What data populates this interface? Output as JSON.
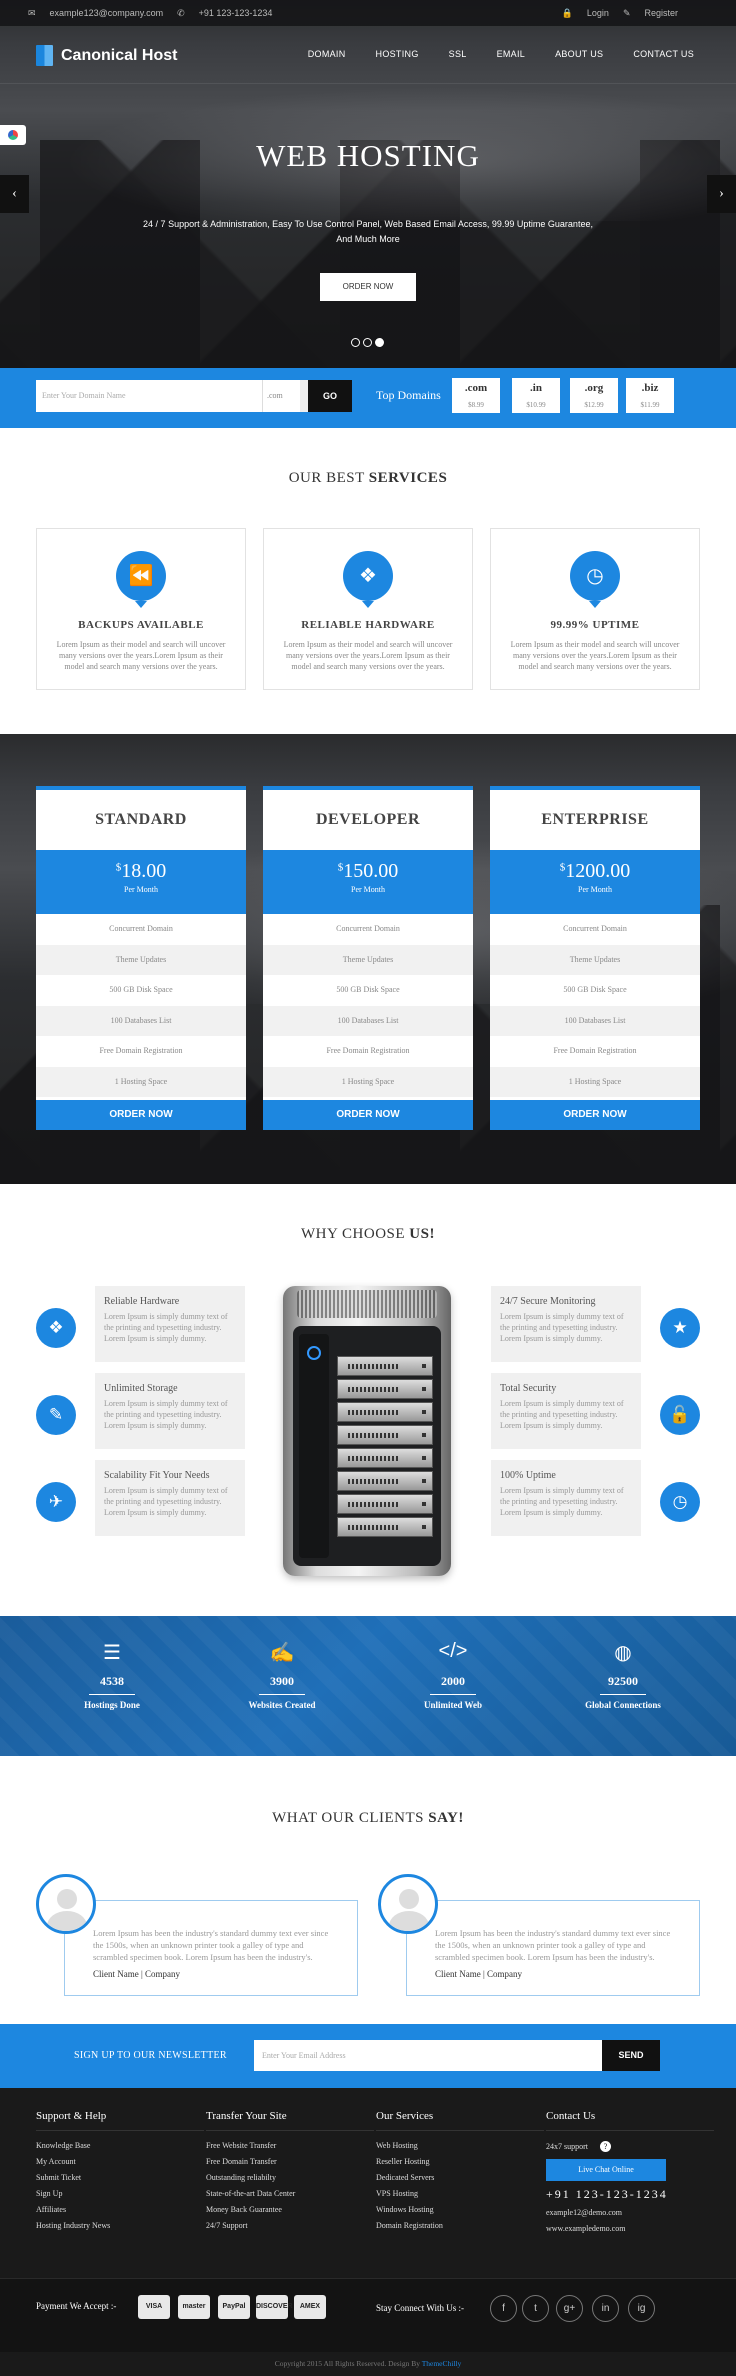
{
  "topbar": {
    "email": "example123@company.com",
    "phone": "+91 123-123-1234",
    "login": "Login",
    "register": "Register"
  },
  "brand": {
    "name": "Canonical Host"
  },
  "menu": [
    "DOMAIN",
    "HOSTING",
    "SSL",
    "EMAIL",
    "ABOUT US",
    "CONTACT US"
  ],
  "hero": {
    "title": "WEB HOSTING",
    "text": "24 / 7 Support & Administration, Easy To Use Control Panel, Web Based Email Access, 99.99 Uptime Guarantee, And Much More",
    "button": "ORDER NOW"
  },
  "domain": {
    "placeholder": "Enter Your Domain Name",
    "ext": ".com",
    "go": "GO",
    "label": "Top Domains",
    "tlds": [
      {
        "name": ".com",
        "price": "$8.99"
      },
      {
        "name": ".in",
        "price": "$10.99"
      },
      {
        "name": ".org",
        "price": "$12.99"
      },
      {
        "name": ".biz",
        "price": "$11.99"
      }
    ]
  },
  "services": {
    "title_a": "OUR BEST ",
    "title_b": "SERVICES",
    "items": [
      {
        "icon": "rewind-icon",
        "title": "BACKUPS AVAILABLE",
        "text": "Lorem Ipsum as their model and search will uncover many versions over the years.Lorem Ipsum as their model and search many versions over the years."
      },
      {
        "icon": "cubes-icon",
        "title": "RELIABLE HARDWARE",
        "text": "Lorem Ipsum as their model and search will uncover many versions over the years.Lorem Ipsum as their model and search many versions over the years."
      },
      {
        "icon": "clock-icon",
        "title": "99.99% UPTIME",
        "text": "Lorem Ipsum as their model and search will uncover many versions over the years.Lorem Ipsum as their model and search many versions over the years."
      }
    ]
  },
  "pricing": [
    {
      "name": "STANDARD",
      "price": "18.00",
      "period": "Per Month",
      "features": [
        "Concurrent Domain",
        "Theme Updates",
        "500 GB Disk Space",
        "100 Databases List",
        "Free Domain Registration",
        "1 Hosting Space"
      ],
      "button": "ORDER NOW"
    },
    {
      "name": "DEVELOPER",
      "price": "150.00",
      "period": "Per Month",
      "features": [
        "Concurrent Domain",
        "Theme Updates",
        "500 GB Disk Space",
        "100 Databases List",
        "Free Domain Registration",
        "1 Hosting Space"
      ],
      "button": "ORDER NOW"
    },
    {
      "name": "ENTERPRISE",
      "price": "1200.00",
      "period": "Per Month",
      "features": [
        "Concurrent Domain",
        "Theme Updates",
        "500 GB Disk Space",
        "100 Databases List",
        "Free Domain Registration",
        "1 Hosting Space"
      ],
      "button": "ORDER NOW"
    }
  ],
  "currency": "$",
  "why": {
    "title_a": "WHY CHOOSE ",
    "title_b": "US!",
    "left": [
      {
        "title": "Reliable Hardware",
        "text": "Lorem Ipsum is simply dummy text of the printing and typesetting industry. Lorem Ipsum is simply dummy."
      },
      {
        "title": "Unlimited Storage",
        "text": "Lorem Ipsum is simply dummy text of the printing and typesetting industry. Lorem Ipsum is simply dummy."
      },
      {
        "title": "Scalability Fit Your Needs",
        "text": "Lorem Ipsum is simply dummy text of the printing and typesetting industry. Lorem Ipsum is simply dummy."
      }
    ],
    "right": [
      {
        "title": "24/7 Secure Monitoring",
        "text": "Lorem Ipsum is simply dummy text of the printing and typesetting industry. Lorem Ipsum is simply dummy."
      },
      {
        "title": "Total Security",
        "text": "Lorem Ipsum is simply dummy text of the printing and typesetting industry. Lorem Ipsum is simply dummy."
      },
      {
        "title": "100% Uptime",
        "text": "Lorem Ipsum is simply dummy text of the printing and typesetting industry. Lorem Ipsum is simply dummy."
      }
    ]
  },
  "stats": [
    {
      "icon": "list-icon",
      "num": "4538",
      "label": "Hostings Done"
    },
    {
      "icon": "edit-icon",
      "num": "3900",
      "label": "Websites Created"
    },
    {
      "icon": "code-icon",
      "num": "2000",
      "label": "Unlimited Web"
    },
    {
      "icon": "globe-icon",
      "num": "92500",
      "label": "Global Connections"
    }
  ],
  "clients": {
    "title_a": "WHAT OUR CLIENTS ",
    "title_b": "SAY!",
    "items": [
      {
        "text": "Lorem Ipsum has been the industry's standard dummy text ever since the 1500s, when an unknown printer took a galley of type and scrambled specimen book. Lorem Ipsum has been the industry's.",
        "name": "Client Name | Company"
      },
      {
        "text": "Lorem Ipsum has been the industry's standard dummy text ever since the 1500s, when an unknown printer took a galley of type and scrambled specimen book. Lorem Ipsum has been the industry's.",
        "name": "Client Name | Company"
      }
    ]
  },
  "newsletter": {
    "label": "SIGN UP TO OUR NEWSLETTER",
    "placeholder": "Enter Your Email Address",
    "button": "SEND"
  },
  "footer": {
    "cols": [
      {
        "title": "Support & Help",
        "items": [
          "Knowledge Base",
          "My Account",
          "Submit Ticket",
          "Sign Up",
          "Affiliates",
          "Hosting Industry News"
        ]
      },
      {
        "title": "Transfer Your Site",
        "items": [
          "Free Website Transfer",
          "Free Domain Transfer",
          "Outstanding reliabilty",
          "State-of-the-art Data Center",
          "Money Back Guarantee",
          "24/7 Support"
        ]
      },
      {
        "title": "Our Services",
        "items": [
          "Web Hosting",
          "Reseller Hosting",
          "Dedicated Servers",
          "VPS Hosting",
          "Windows Hosting",
          "Domain Registration"
        ]
      }
    ],
    "contact": {
      "title": "Contact Us",
      "support": "24x7 support",
      "chat": "Live Chat Online",
      "phone": "+91 123-123-1234",
      "email": "example12@demo.com",
      "web": "www.exampledemo.com"
    },
    "pay_label": "Payment We Accept :-",
    "cards": [
      "VISA",
      "master",
      "PayPal",
      "DISCOVER",
      "AMEX"
    ],
    "stay": "Stay Connect With Us :-",
    "social": [
      "f",
      "t",
      "g+",
      "in",
      "ig"
    ],
    "copy_a": "Copyright 2015 All Rights Reserved. Design By ",
    "copy_b": "ThemeChilly"
  },
  "colors": {
    "accent": "#1d87e0",
    "dark": "#1a1a1a"
  }
}
